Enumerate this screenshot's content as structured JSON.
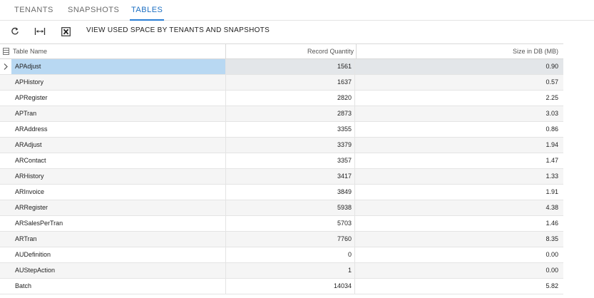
{
  "tabs": [
    {
      "label": "TENANTS"
    },
    {
      "label": "SNAPSHOTS"
    },
    {
      "label": "TABLES"
    }
  ],
  "toolbar": {
    "refresh_icon": "refresh-icon",
    "fit_icon": "fit-columns-icon",
    "export_icon": "excel-export-icon",
    "view_used_space_label": "VIEW USED SPACE BY TENANTS AND SNAPSHOTS"
  },
  "grid": {
    "headers": {
      "table_name": "Table Name",
      "record_quantity": "Record Quantity",
      "size_in_db": "Size in DB (MB)"
    },
    "rows": [
      {
        "name": "APAdjust",
        "qty": "1561",
        "size": "0.90"
      },
      {
        "name": "APHistory",
        "qty": "1637",
        "size": "0.57"
      },
      {
        "name": "APRegister",
        "qty": "2820",
        "size": "2.25"
      },
      {
        "name": "APTran",
        "qty": "2873",
        "size": "3.03"
      },
      {
        "name": "ARAddress",
        "qty": "3355",
        "size": "0.86"
      },
      {
        "name": "ARAdjust",
        "qty": "3379",
        "size": "1.94"
      },
      {
        "name": "ARContact",
        "qty": "3357",
        "size": "1.47"
      },
      {
        "name": "ARHistory",
        "qty": "3417",
        "size": "1.33"
      },
      {
        "name": "ARInvoice",
        "qty": "3849",
        "size": "1.91"
      },
      {
        "name": "ARRegister",
        "qty": "5938",
        "size": "4.38"
      },
      {
        "name": "ARSalesPerTran",
        "qty": "5703",
        "size": "1.46"
      },
      {
        "name": "ARTran",
        "qty": "7760",
        "size": "8.35"
      },
      {
        "name": "AUDefinition",
        "qty": "0",
        "size": "0.00"
      },
      {
        "name": "AUStepAction",
        "qty": "1",
        "size": "0.00"
      },
      {
        "name": "Batch",
        "qty": "14034",
        "size": "5.82"
      }
    ]
  },
  "colors": {
    "accent": "#1c6fc2",
    "selected_row": "#b8d8f2",
    "alt_row": "#f5f5f5"
  }
}
